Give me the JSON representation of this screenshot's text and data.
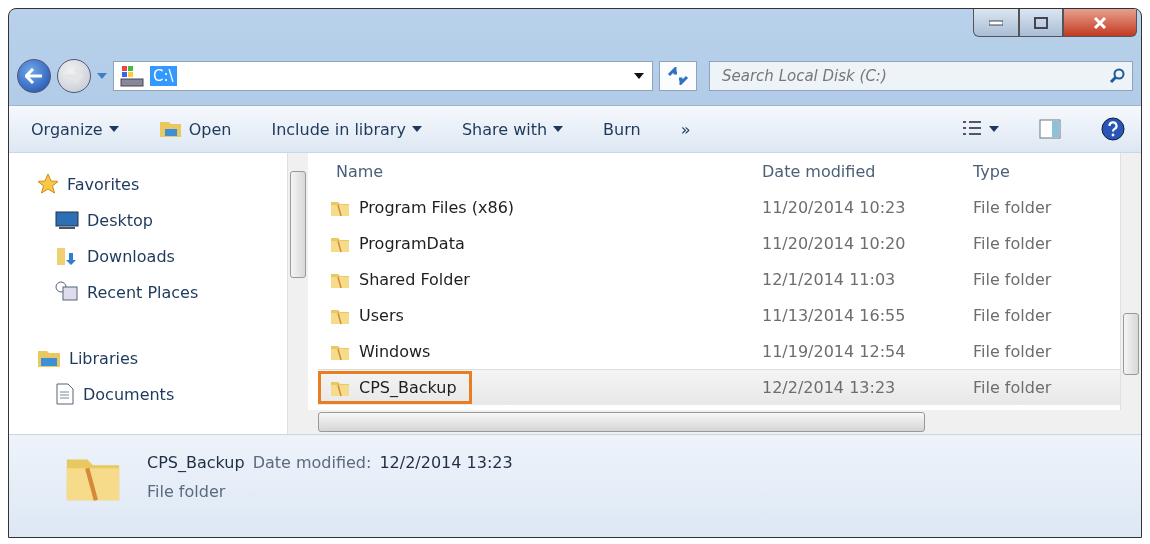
{
  "address_bar": {
    "path": "C:\\",
    "search_placeholder": "Search Local Disk (C:)"
  },
  "toolbar": {
    "items": [
      {
        "label": "Organize",
        "kind": "menu"
      },
      {
        "label": "Open",
        "kind": "icon"
      },
      {
        "label": "Include in library",
        "kind": "menu"
      },
      {
        "label": "Share with",
        "kind": "menu"
      },
      {
        "label": "Burn",
        "kind": "plain"
      },
      {
        "label": "»",
        "kind": "plain"
      }
    ]
  },
  "sidebar": {
    "groups": [
      {
        "label": "Favorites",
        "children": [
          {
            "label": "Desktop"
          },
          {
            "label": "Downloads"
          },
          {
            "label": "Recent Places"
          }
        ]
      },
      {
        "label": "Libraries",
        "children": [
          {
            "label": "Documents"
          }
        ]
      }
    ]
  },
  "table": {
    "columns": [
      "Name",
      "Date modified",
      "Type"
    ],
    "rows": [
      {
        "name": "Program Files (x86)",
        "date": "11/20/2014 10:23",
        "type": "File folder",
        "selected": false,
        "outlined": false
      },
      {
        "name": "ProgramData",
        "date": "11/20/2014 10:20",
        "type": "File folder",
        "selected": false,
        "outlined": false
      },
      {
        "name": "Shared Folder",
        "date": "12/1/2014 11:03",
        "type": "File folder",
        "selected": false,
        "outlined": false
      },
      {
        "name": "Users",
        "date": "11/13/2014 16:55",
        "type": "File folder",
        "selected": false,
        "outlined": false
      },
      {
        "name": "Windows",
        "date": "11/19/2014 12:54",
        "type": "File folder",
        "selected": false,
        "outlined": false
      },
      {
        "name": "CPS_Backup",
        "date": "12/2/2014 13:23",
        "type": "File folder",
        "selected": true,
        "outlined": true
      }
    ]
  },
  "details": {
    "name": "CPS_Backup",
    "label": "Date modified:",
    "value": "12/2/2014 13:23",
    "type": "File folder"
  }
}
